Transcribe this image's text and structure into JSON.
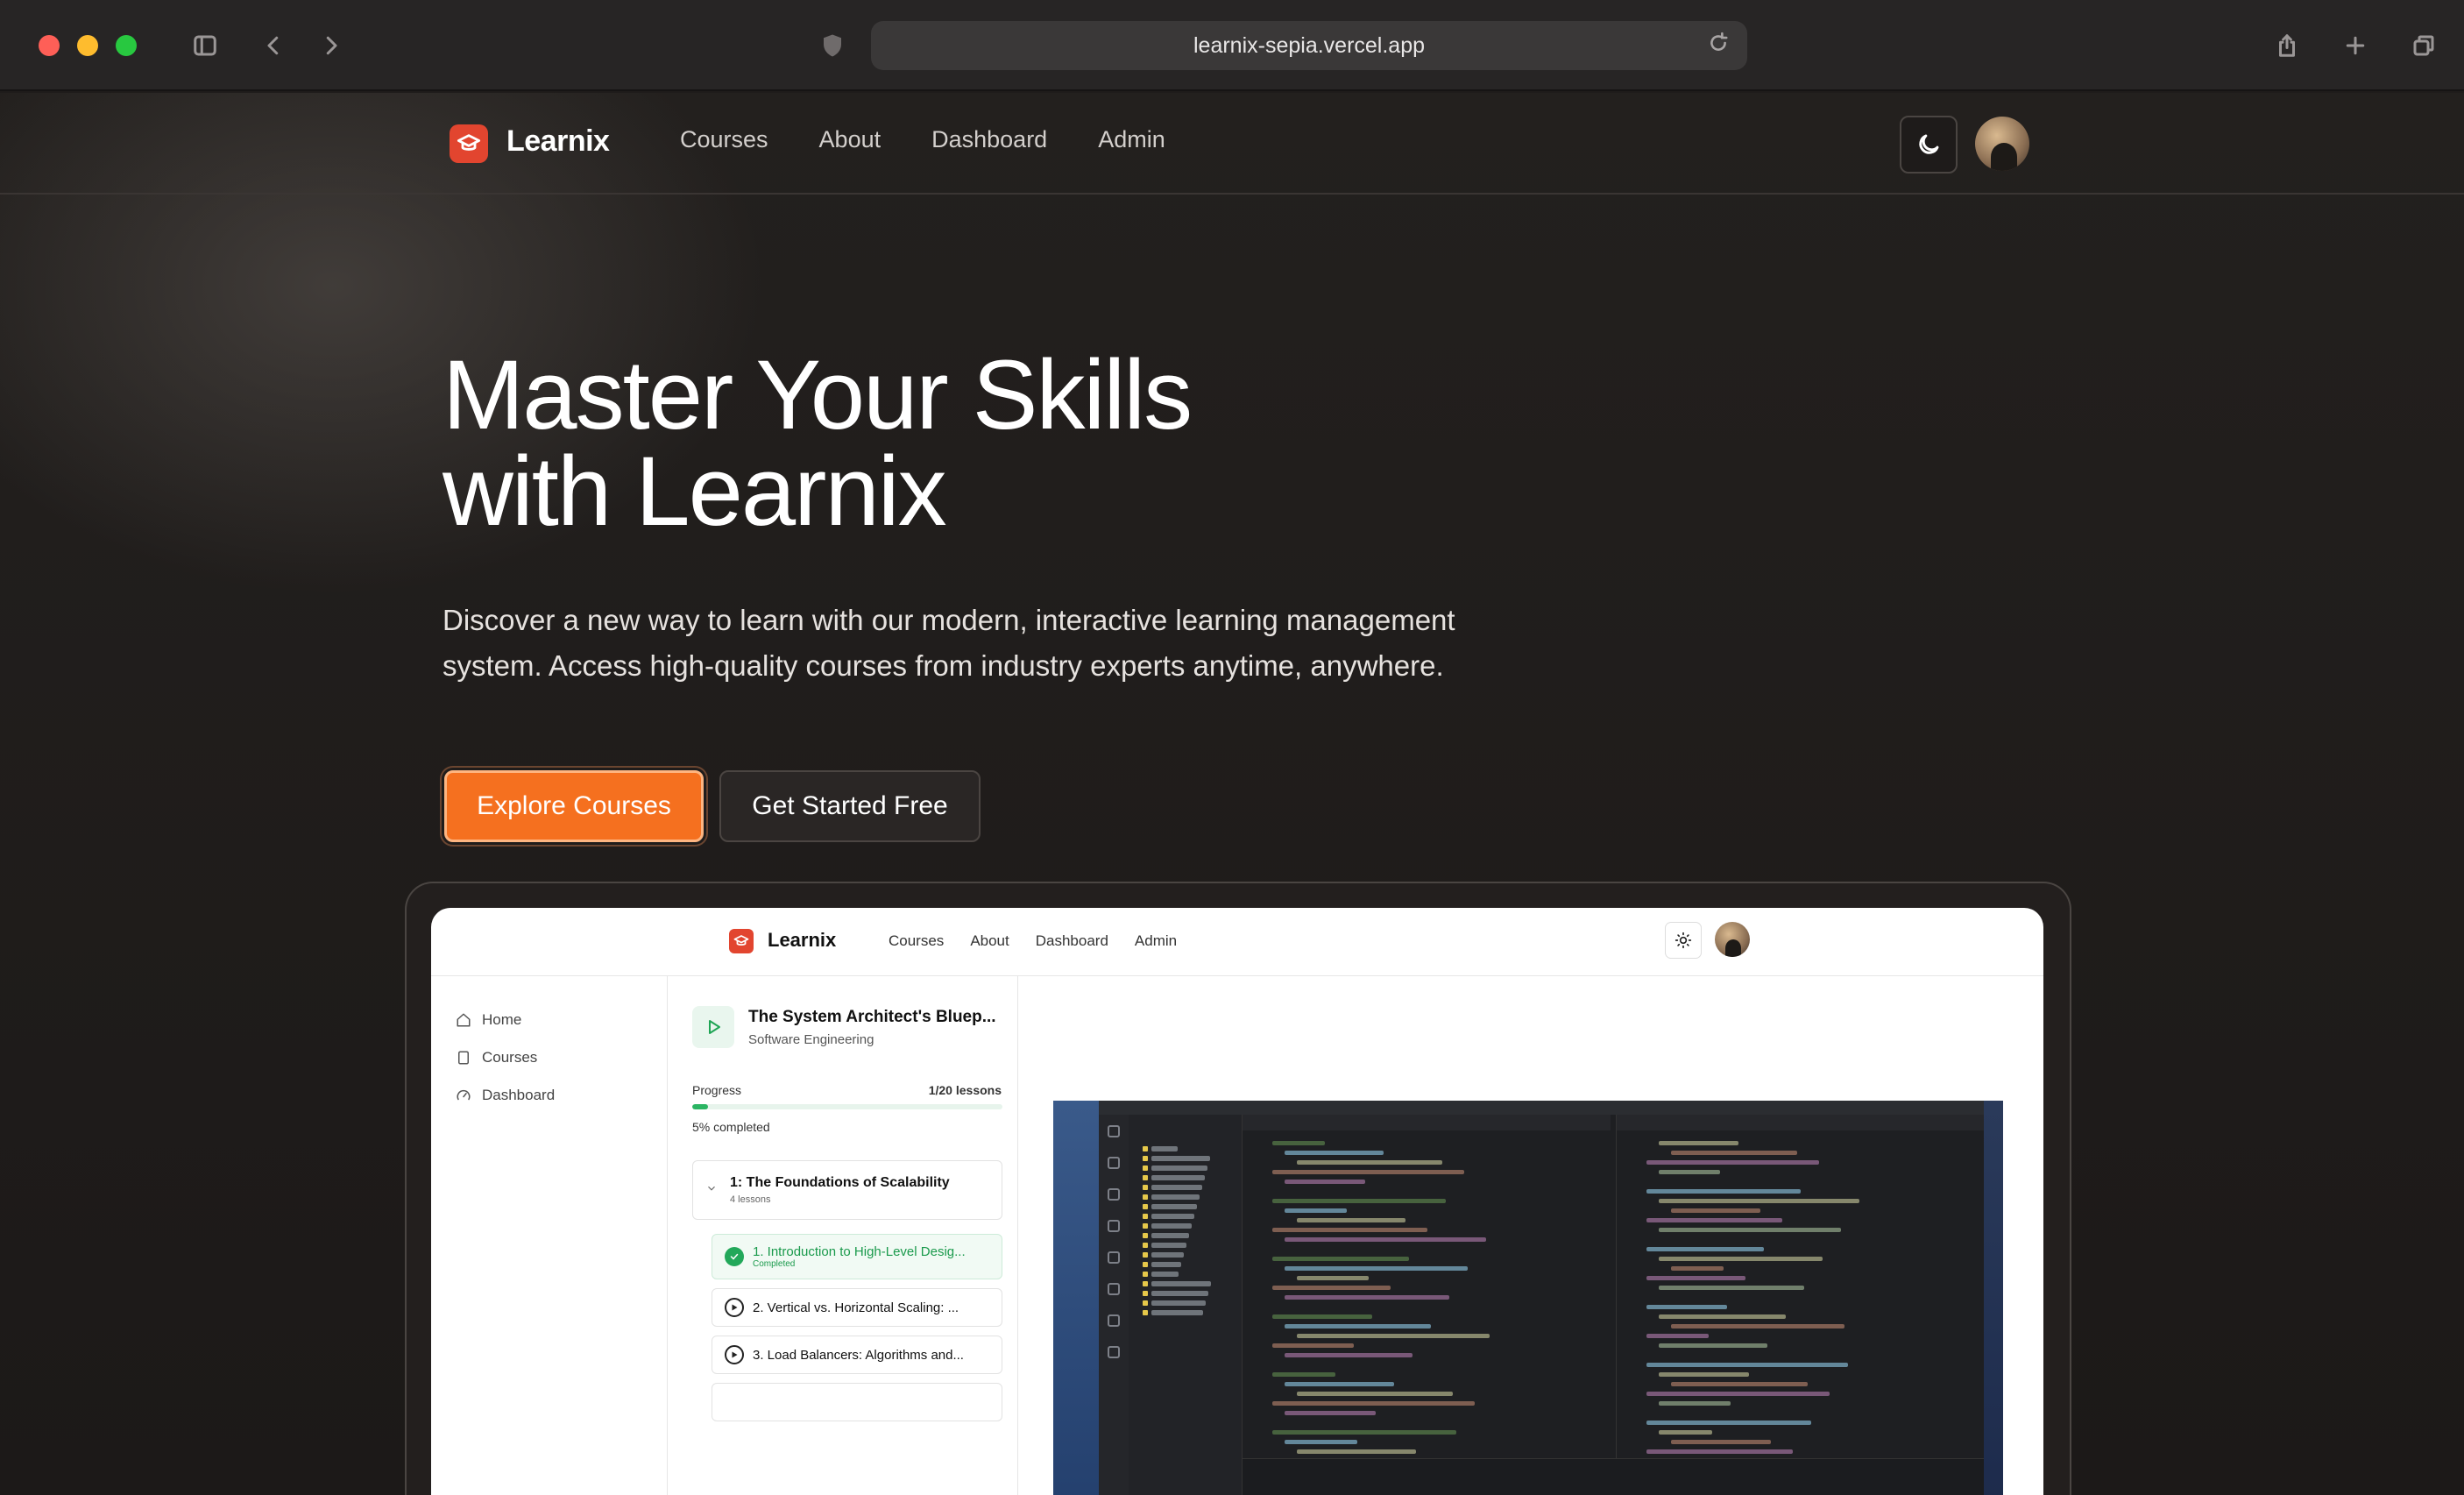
{
  "browser": {
    "url": "learnix-sepia.vercel.app"
  },
  "site": {
    "brand": "Learnix",
    "nav": [
      "Courses",
      "About",
      "Dashboard",
      "Admin"
    ]
  },
  "hero": {
    "title_line1": "Master Your Skills",
    "title_line2": "with Learnix",
    "description": "Discover a new way to learn with our modern, interactive learning management system. Access high-quality courses from industry experts anytime, anywhere.",
    "primary_cta": "Explore Courses",
    "secondary_cta": "Get Started Free"
  },
  "preview": {
    "brand": "Learnix",
    "nav": [
      "Courses",
      "About",
      "Dashboard",
      "Admin"
    ],
    "sidebar": [
      "Home",
      "Courses",
      "Dashboard"
    ],
    "course": {
      "title": "The System Architect's Bluep...",
      "subtitle": "Software Engineering",
      "progress_label": "Progress",
      "progress_count": "1/20 lessons",
      "progress_fraction": 0.05,
      "progress_text": "5% completed"
    },
    "module": {
      "title": "1: The Foundations of Scalability",
      "subtitle": "4 lessons"
    },
    "lessons": [
      {
        "title": "1. Introduction to High-Level Desig...",
        "status": "Completed"
      },
      {
        "title": "2. Vertical vs. Horizontal Scaling: ...",
        "status": ""
      },
      {
        "title": "3. Load Balancers: Algorithms and...",
        "status": ""
      }
    ]
  },
  "colors": {
    "accent": "#f5701f",
    "brand_logo": "#e2452f",
    "success": "#22a85a"
  },
  "icons": {
    "sidebar_toggle": "sidebar-icon",
    "back": "chevron-left-icon",
    "forward": "chevron-right-icon",
    "shield": "shield-icon",
    "reload": "reload-icon",
    "share": "share-icon",
    "new_tab": "plus-icon",
    "tabs": "tabs-icon",
    "theme": "moon-icon",
    "preview_theme": "sun-icon"
  }
}
